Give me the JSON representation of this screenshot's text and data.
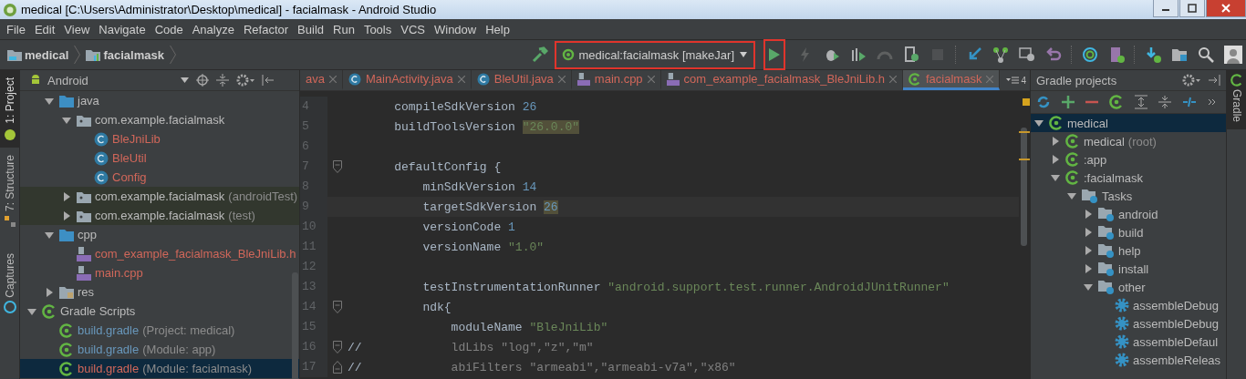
{
  "window": {
    "title": "medical [C:\\Users\\Administrator\\Desktop\\medical] - facialmask - Android Studio"
  },
  "menu": [
    "File",
    "Edit",
    "View",
    "Navigate",
    "Code",
    "Analyze",
    "Refactor",
    "Build",
    "Run",
    "Tools",
    "VCS",
    "Window",
    "Help"
  ],
  "breadcrumbs": [
    {
      "label": "medical",
      "kind": "project"
    },
    {
      "label": "facialmask",
      "kind": "module"
    }
  ],
  "run_config": {
    "label": "medical:facialmask [makeJar]",
    "highlighted": true
  },
  "run_button": {
    "highlighted": true
  },
  "left_tool_tabs": [
    {
      "label": "1: Project",
      "kind": "project",
      "selected": true
    },
    {
      "label": "7: Structure",
      "kind": "structure",
      "selected": false
    },
    {
      "label": "Captures",
      "kind": "captures",
      "selected": false
    }
  ],
  "right_tool_tabs": [
    {
      "label": "Gradle",
      "selected": true
    }
  ],
  "project_panel": {
    "view": "Android",
    "module_items": [
      {
        "label": "java",
        "kind": "folder",
        "expanded": true,
        "children": [
          {
            "label": "com.example.facialmask",
            "kind": "package",
            "expanded": true,
            "children": [
              {
                "label": "BleJniLib",
                "kind": "class",
                "color": "#d1675a"
              },
              {
                "label": "BleUtil",
                "kind": "class",
                "color": "#d1675a"
              },
              {
                "label": "Config",
                "kind": "class",
                "color": "#d1675a"
              }
            ]
          },
          {
            "label": "com.example.facialmask",
            "note": "(androidTest)",
            "kind": "test-package",
            "expanded": false
          },
          {
            "label": "com.example.facialmask",
            "note": "(test)",
            "kind": "test-package",
            "expanded": false
          }
        ]
      },
      {
        "label": "cpp",
        "kind": "folder",
        "expanded": true,
        "children": [
          {
            "label": "com_example_facialmask_BleJniLib.h",
            "kind": "cpp",
            "color": "#d1675a"
          },
          {
            "label": "main.cpp",
            "kind": "cpp",
            "color": "#d1675a"
          }
        ]
      },
      {
        "label": "res",
        "kind": "res",
        "expanded": false
      }
    ],
    "root_items": [
      {
        "label": "Gradle Scripts",
        "kind": "gradle",
        "expanded": true,
        "children": [
          {
            "label": "build.gradle",
            "note": "(Project: medical)",
            "kind": "gradle",
            "color": "#6897bb",
            "selected": false
          },
          {
            "label": "build.gradle",
            "note": "(Module: app)",
            "kind": "gradle",
            "color": "#6897bb",
            "selected": false
          },
          {
            "label": "build.gradle",
            "note": "(Module: facialmask)",
            "kind": "gradle",
            "color": "#d1675a",
            "selected": true
          }
        ]
      }
    ]
  },
  "editor_tabs": [
    {
      "label": "ava",
      "kind": "plain",
      "selected": false
    },
    {
      "label": "MainActivity.java",
      "kind": "class",
      "selected": false
    },
    {
      "label": "BleUtil.java",
      "kind": "class",
      "selected": false
    },
    {
      "label": "main.cpp",
      "kind": "cpp",
      "selected": false
    },
    {
      "label": "com_example_facialmask_BleJniLib.h",
      "kind": "cpp",
      "selected": false
    },
    {
      "label": "facialmask",
      "kind": "gradle",
      "selected": true
    }
  ],
  "hidden_tab_count": "4",
  "code_lines": [
    {
      "number": "4",
      "tokens": [
        {
          "kind": "plain",
          "text": "compileSdkVersion"
        },
        {
          "kind": "number",
          "text": "26"
        }
      ]
    },
    {
      "number": "5",
      "tokens": [
        {
          "kind": "plain",
          "text": "buildToolsVersion"
        },
        {
          "kind": "string",
          "text": "\"26.0.0\"",
          "highlighted": true
        }
      ]
    },
    {
      "number": "6"
    },
    {
      "number": "7",
      "kind": "fold-start",
      "tokens": [
        {
          "kind": "plain",
          "text": "defaultConfig {"
        }
      ],
      "children": [
        {
          "number": "8",
          "tokens": [
            {
              "kind": "plain",
              "text": "minSdkVersion"
            },
            {
              "kind": "number",
              "text": "14"
            }
          ]
        },
        {
          "number": "9",
          "current": true,
          "tokens": [
            {
              "kind": "plain",
              "text": "targetSdkVersion"
            },
            {
              "kind": "number",
              "text": "26",
              "highlighted": true
            }
          ]
        },
        {
          "number": "10",
          "tokens": [
            {
              "kind": "plain",
              "text": "versionCode"
            },
            {
              "kind": "number",
              "text": "1"
            }
          ]
        },
        {
          "number": "11",
          "tokens": [
            {
              "kind": "plain",
              "text": "versionName"
            },
            {
              "kind": "string",
              "text": "\"1.0\""
            }
          ]
        },
        {
          "number": "12"
        },
        {
          "number": "13",
          "tokens": [
            {
              "kind": "plain",
              "text": "testInstrumentationRunner"
            },
            {
              "kind": "string",
              "text": "\"android.support.test.runner.AndroidJUnitRunner\""
            }
          ]
        },
        {
          "number": "14",
          "kind": "fold-start",
          "tokens": [
            {
              "kind": "plain",
              "text": "ndk{"
            }
          ],
          "children": [
            {
              "number": "15",
              "tokens": [
                {
                  "kind": "plain",
                  "text": "moduleName"
                },
                {
                  "kind": "string",
                  "text": "\"BleJniLib\""
                }
              ]
            },
            {
              "number": "16",
              "kind": "fold-start",
              "comment": "//",
              "tokens": [
                {
                  "kind": "comment",
                  "text": "ldLibs \"log\",\"z\",\"m\""
                }
              ]
            },
            {
              "number": "17",
              "kind": "fold-end",
              "comment": "//",
              "tokens": [
                {
                  "kind": "comment",
                  "text": "abiFilters \"armeabi\",\"armeabi-v7a\",\"x86\""
                }
              ]
            }
          ]
        }
      ]
    }
  ],
  "gradle_panel": {
    "title": "Gradle projects",
    "tree": [
      {
        "label": "medical",
        "kind": "gradle",
        "expanded": true,
        "selected": true,
        "children": [
          {
            "label": "medical",
            "note": "(root)",
            "kind": "gradle",
            "expanded": false,
            "selected": false
          },
          {
            "label": ":app",
            "kind": "gradle",
            "expanded": false,
            "selected": false
          },
          {
            "label": ":facialmask",
            "kind": "gradle",
            "expanded": true,
            "selected": false,
            "children": [
              {
                "label": "Tasks",
                "kind": "taskfolder",
                "expanded": true,
                "selected": false,
                "children": [
                  {
                    "label": "android",
                    "kind": "taskfolder",
                    "expanded": false,
                    "selected": false
                  },
                  {
                    "label": "build",
                    "kind": "taskfolder",
                    "expanded": false,
                    "selected": false
                  },
                  {
                    "label": "help",
                    "kind": "taskfolder",
                    "expanded": false,
                    "selected": false
                  },
                  {
                    "label": "install",
                    "kind": "taskfolder",
                    "expanded": false,
                    "selected": false
                  },
                  {
                    "label": "other",
                    "kind": "taskfolder",
                    "expanded": true,
                    "selected": false,
                    "children": [
                      {
                        "label": "assembleDebug",
                        "kind": "task",
                        "selected": false
                      },
                      {
                        "label": "assembleDebug",
                        "kind": "task",
                        "selected": false
                      },
                      {
                        "label": "assembleDefaul",
                        "kind": "task",
                        "selected": false
                      },
                      {
                        "label": "assembleReleas",
                        "kind": "task",
                        "selected": false
                      }
                    ]
                  }
                ]
              }
            ]
          }
        ]
      }
    ]
  }
}
